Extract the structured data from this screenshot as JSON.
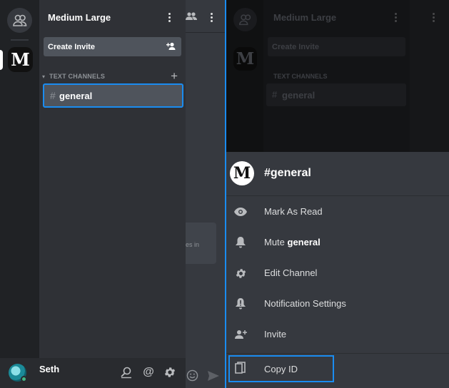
{
  "server": {
    "name": "Medium Large",
    "logo_letter": "M",
    "invite_label": "Create Invite",
    "category_label": "TEXT CHANNELS",
    "channel_hash": "#",
    "channel_name": "general"
  },
  "user": {
    "name": "Seth",
    "status_color": "#43b581"
  },
  "chat_peek": {
    "card_text": "es in"
  },
  "sheet": {
    "title": "#general",
    "items": [
      {
        "label": "Mark As Read",
        "icon": "eye-icon"
      },
      {
        "label": "Mute ",
        "label_bold": "general",
        "icon": "bell-icon"
      },
      {
        "label": "Edit Channel",
        "icon": "gear-icon"
      },
      {
        "label": "Notification Settings",
        "icon": "bell-alert-icon"
      },
      {
        "label": "Invite",
        "icon": "add-user-icon"
      }
    ],
    "copy_label": "Copy ID"
  },
  "colors": {
    "accent": "#1a8cf0",
    "sidebar": "#2f3136",
    "rail": "#202225",
    "sheet": "#36393f"
  }
}
